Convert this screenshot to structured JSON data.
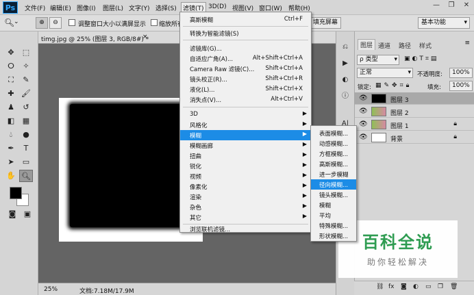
{
  "app": {
    "logo": "Ps",
    "menu": [
      "文件(F)",
      "编辑(E)",
      "图像(I)",
      "图层(L)",
      "文字(Y)",
      "选择(S)",
      "滤镜(T)",
      "3D(D)",
      "视图(V)",
      "窗口(W)",
      "帮助(H)"
    ],
    "active_menu": "滤镜(T)"
  },
  "options": {
    "checkbox1": "调整窗口大小以满屏显示",
    "checkbox2": "缩放所有",
    "fill_screen": "填充屏幕",
    "workspace": "基本功能"
  },
  "document": {
    "tab": "timg.jpg @ 25% (图层 3, RGB/8#) *",
    "zoom": "25%",
    "doc_info": "文档:7.18M/17.9M"
  },
  "filter_menu": {
    "items": [
      {
        "label": "高斯模糊",
        "shortcut": "Ctrl+F"
      },
      {
        "label": "转换为智能滤镜(S)",
        "shortcut": ""
      },
      {
        "label": "滤镜库(G)...",
        "shortcut": ""
      },
      {
        "label": "自适应广角(A)...",
        "shortcut": "Alt+Shift+Ctrl+A"
      },
      {
        "label": "Camera Raw 滤镜(C)...",
        "shortcut": "Shift+Ctrl+A"
      },
      {
        "label": "镜头校正(R)...",
        "shortcut": "Shift+Ctrl+R"
      },
      {
        "label": "液化(L)...",
        "shortcut": "Shift+Ctrl+X"
      },
      {
        "label": "消失点(V)...",
        "shortcut": "Alt+Ctrl+V"
      },
      {
        "label": "3D",
        "shortcut": ""
      },
      {
        "label": "风格化",
        "shortcut": ""
      },
      {
        "label": "模糊",
        "shortcut": ""
      },
      {
        "label": "模糊画廊",
        "shortcut": ""
      },
      {
        "label": "扭曲",
        "shortcut": ""
      },
      {
        "label": "锐化",
        "shortcut": ""
      },
      {
        "label": "视频",
        "shortcut": ""
      },
      {
        "label": "像素化",
        "shortcut": ""
      },
      {
        "label": "渲染",
        "shortcut": ""
      },
      {
        "label": "杂色",
        "shortcut": ""
      },
      {
        "label": "其它",
        "shortcut": ""
      },
      {
        "label": "浏览联机滤镜...",
        "shortcut": ""
      }
    ],
    "highlighted": "模糊"
  },
  "blur_submenu": {
    "items": [
      "表面模糊...",
      "动感模糊...",
      "方框模糊...",
      "高斯模糊...",
      "进一步模糊",
      "径向模糊...",
      "镜头模糊...",
      "模糊",
      "平均",
      "特殊模糊...",
      "形状模糊..."
    ],
    "highlighted": "径向模糊..."
  },
  "layers_panel": {
    "tabs": [
      "图层",
      "通道",
      "路径",
      "样式"
    ],
    "kind_filter": "ρ 类型",
    "blend_mode": "正常",
    "opacity_label": "不透明度:",
    "opacity_value": "100%",
    "lock_label": "锁定:",
    "fill_label": "填充:",
    "fill_value": "100%",
    "layers": [
      {
        "name": "图层 3",
        "selected": true,
        "locked": false
      },
      {
        "name": "图层 2",
        "selected": false,
        "locked": false
      },
      {
        "name": "图层 1",
        "selected": false,
        "locked": true
      },
      {
        "name": "背景",
        "selected": false,
        "locked": true
      }
    ]
  },
  "watermark": {
    "title": "百科全说",
    "subtitle": "助你轻松解决"
  },
  "colors": {
    "highlight": "#1c8ce6",
    "watermark_green": "#2e9c51"
  }
}
